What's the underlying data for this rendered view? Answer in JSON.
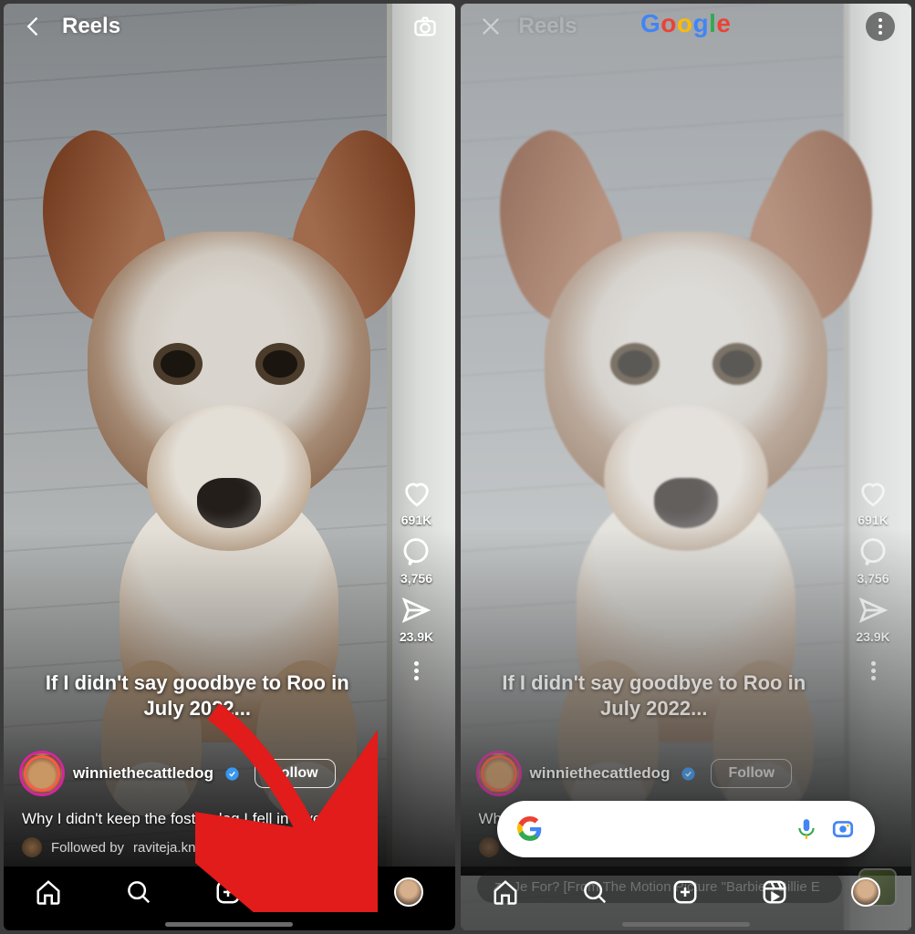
{
  "header": {
    "title": "Reels"
  },
  "overlay_caption": "If I didn't say goodbye to Roo in July 2022...",
  "user": {
    "username": "winniethecattledog",
    "verified": true,
    "follow_label": "Follow"
  },
  "description": "Why I didn't keep the foster dog I fell in love wit ...",
  "followed_by": {
    "prefix": "Followed by",
    "name": "raviteja.knts"
  },
  "audio": {
    "track_left": "Made For? [From The Motion Picture \"Barbie\"]   Billi",
    "track_right": "Je For? [From The Motion Picture \"Barbie\"]   Billie E"
  },
  "stats": {
    "likes": "691K",
    "comments": "3,756",
    "shares": "23.9K"
  },
  "google": {
    "title": "Google"
  }
}
